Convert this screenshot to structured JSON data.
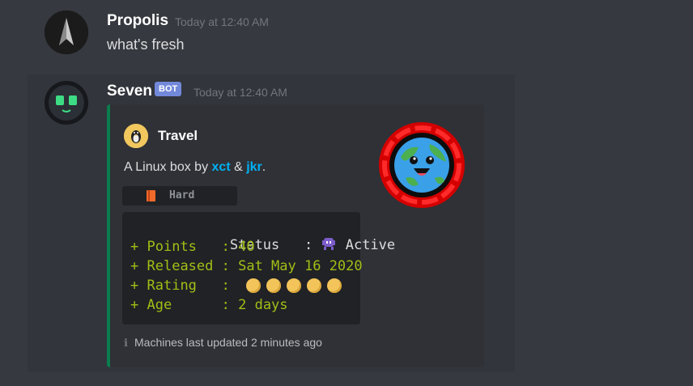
{
  "colors": {
    "background": "#36393f",
    "hover_bg": "#32353b",
    "embed_bg": "#2f3136",
    "embed_accent": "#0a7d4f",
    "bot_tag": "#7289da",
    "mention": "#00b0f4",
    "code_green": "#a3be16",
    "timestamp": "#72767d"
  },
  "messages": [
    {
      "username": "Propolis",
      "timestamp": "Today at 12:40 AM",
      "content": "what's fresh",
      "avatar": "starfleet-badge-icon"
    },
    {
      "username": "Seven",
      "bot_tag": "BOT",
      "timestamp": "Today at 12:40 AM",
      "avatar": "robot-face-icon",
      "embed": {
        "author": {
          "name": "Travel",
          "icon": "linux-penguin-icon"
        },
        "description": {
          "prefix": "A Linux box by ",
          "user1": "xct",
          "amp": " & ",
          "user2": "jkr",
          "suffix": "."
        },
        "difficulty": {
          "icon": "orange-book-icon",
          "label": "Hard"
        },
        "stats": [
          {
            "prefix": " ",
            "label": "Status  ",
            "sep": " : ",
            "value": "Active",
            "icon": "alien-monster-icon"
          },
          {
            "prefix": "+",
            "label": "Points  ",
            "sep": " : ",
            "value": "40"
          },
          {
            "prefix": "+",
            "label": "Released",
            "sep": " : ",
            "value": "Sat May 16 2020"
          },
          {
            "prefix": "+",
            "label": "Rating  ",
            "sep": " : ",
            "value": "",
            "stars": 5,
            "icon": "star-coin-icon"
          },
          {
            "prefix": "+",
            "label": "Age     ",
            "sep": " : ",
            "value": "2 days"
          }
        ],
        "footer": {
          "icon": "info-icon",
          "glyph": "ℹ",
          "text": "Machines last updated 2 minutes ago"
        },
        "thumbnail": "happy-earth-red-ring-icon"
      }
    }
  ]
}
